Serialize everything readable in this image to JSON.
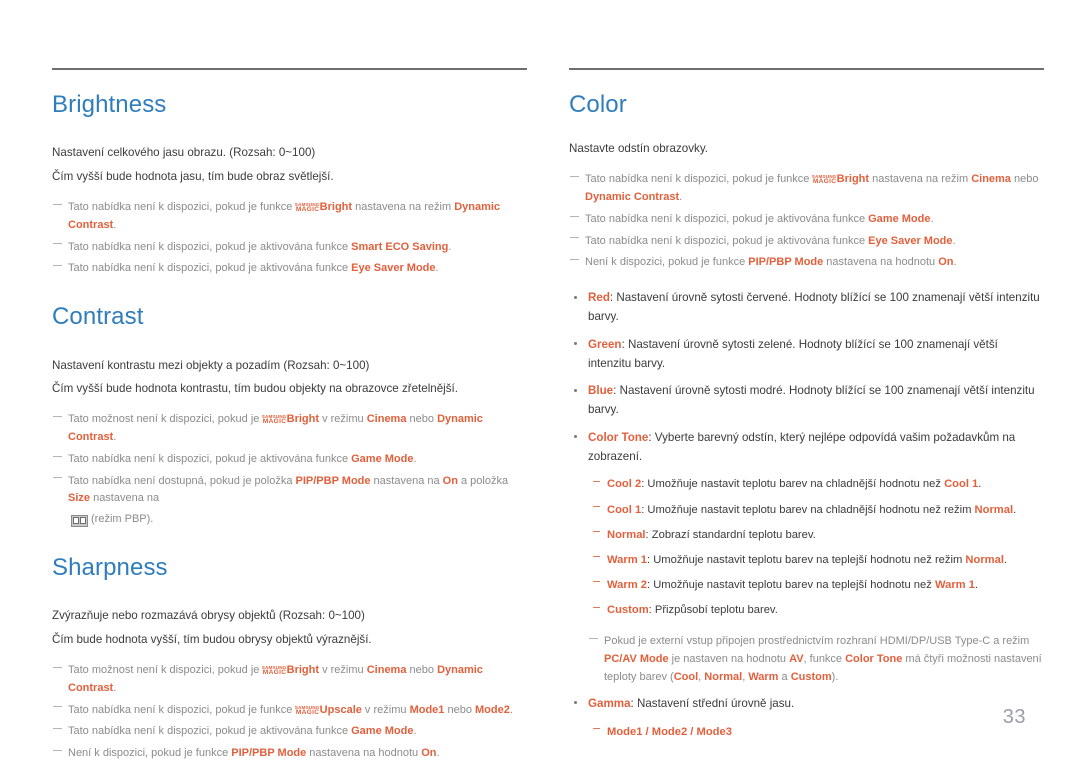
{
  "page_number": "33",
  "colors": {
    "heading": "#2f7dbd",
    "highlight": "#e2603c",
    "body": "#3b3b3b",
    "note": "#8b8b8b",
    "page_number": "#9a9fa6",
    "rule": "#6d6e71"
  },
  "magic_logo": {
    "line1": "SAMSUNG",
    "line2": "MAGIC"
  },
  "left_column": {
    "brightness": {
      "title": "Brightness",
      "body": [
        "Nastavení celkového jasu obrazu. (Rozsah: 0~100)",
        "Čím vyšší bude hodnota jasu, tím bude obraz světlejší."
      ],
      "notes": [
        {
          "parts": [
            {
              "t": "Tato nabídka není k dispozici, pokud je funkce ",
              "s": "plain"
            },
            {
              "t": "MAGIC_LOGO",
              "s": "magic"
            },
            {
              "t": "Bright",
              "s": "magicword"
            },
            {
              "t": " nastavena na režim ",
              "s": "plain"
            },
            {
              "t": "Dynamic Contrast",
              "s": "hl"
            },
            {
              "t": ".",
              "s": "plain"
            }
          ]
        },
        {
          "parts": [
            {
              "t": "Tato nabídka není k dispozici, pokud je aktivována funkce ",
              "s": "plain"
            },
            {
              "t": "Smart ECO Saving",
              "s": "hl"
            },
            {
              "t": ".",
              "s": "plain"
            }
          ]
        },
        {
          "parts": [
            {
              "t": "Tato nabídka není k dispozici, pokud je aktivována funkce ",
              "s": "plain"
            },
            {
              "t": "Eye Saver Mode",
              "s": "hl"
            },
            {
              "t": ".",
              "s": "plain"
            }
          ]
        }
      ]
    },
    "contrast": {
      "title": "Contrast",
      "body": [
        "Nastavení kontrastu mezi objekty a pozadím (Rozsah: 0~100)",
        "Čím vyšší bude hodnota kontrastu, tím budou objekty na obrazovce zřetelnější."
      ],
      "notes": [
        {
          "parts": [
            {
              "t": "Tato možnost není k dispozici, pokud je ",
              "s": "plain"
            },
            {
              "t": "MAGIC_LOGO",
              "s": "magic"
            },
            {
              "t": "Bright",
              "s": "magicword"
            },
            {
              "t": " v režimu ",
              "s": "plain"
            },
            {
              "t": "Cinema",
              "s": "hl"
            },
            {
              "t": " nebo ",
              "s": "plain"
            },
            {
              "t": "Dynamic Contrast",
              "s": "hl"
            },
            {
              "t": ".",
              "s": "plain"
            }
          ]
        },
        {
          "parts": [
            {
              "t": "Tato nabídka není k dispozici, pokud je aktivována funkce ",
              "s": "plain"
            },
            {
              "t": "Game Mode",
              "s": "hl"
            },
            {
              "t": ".",
              "s": "plain"
            }
          ]
        }
      ],
      "pbp_note": {
        "line1_parts": [
          {
            "t": "Tato nabídka není dostupná, pokud je položka ",
            "s": "plain"
          },
          {
            "t": "PIP/PBP Mode",
            "s": "hl"
          },
          {
            "t": " nastavena na ",
            "s": "plain"
          },
          {
            "t": "On",
            "s": "hl"
          },
          {
            "t": " a položka ",
            "s": "plain"
          },
          {
            "t": "Size",
            "s": "hl"
          },
          {
            "t": " nastavena na",
            "s": "plain"
          }
        ],
        "line2_suffix": "(režim PBP)."
      }
    },
    "sharpness": {
      "title": "Sharpness",
      "body": [
        "Zvýrazňuje nebo rozmazává obrysy objektů (Rozsah: 0~100)",
        "Čím bude hodnota vyšší, tím budou obrysy objektů výraznější."
      ],
      "notes": [
        {
          "parts": [
            {
              "t": "Tato možnost není k dispozici, pokud je ",
              "s": "plain"
            },
            {
              "t": "MAGIC_LOGO",
              "s": "magic"
            },
            {
              "t": "Bright",
              "s": "magicword"
            },
            {
              "t": " v režimu ",
              "s": "plain"
            },
            {
              "t": "Cinema",
              "s": "hl"
            },
            {
              "t": " nebo ",
              "s": "plain"
            },
            {
              "t": "Dynamic Contrast",
              "s": "hl"
            },
            {
              "t": ".",
              "s": "plain"
            }
          ]
        },
        {
          "parts": [
            {
              "t": "Tato nabídka není k dispozici, pokud je funkce ",
              "s": "plain"
            },
            {
              "t": "MAGIC_LOGO",
              "s": "magic"
            },
            {
              "t": "Upscale",
              "s": "magicword"
            },
            {
              "t": " v režimu ",
              "s": "plain"
            },
            {
              "t": "Mode1",
              "s": "hl"
            },
            {
              "t": " nebo ",
              "s": "plain"
            },
            {
              "t": "Mode2",
              "s": "hl"
            },
            {
              "t": ".",
              "s": "plain"
            }
          ]
        },
        {
          "parts": [
            {
              "t": "Tato nabídka není k dispozici, pokud je aktivována funkce ",
              "s": "plain"
            },
            {
              "t": "Game Mode",
              "s": "hl"
            },
            {
              "t": ".",
              "s": "plain"
            }
          ]
        },
        {
          "parts": [
            {
              "t": "Není k dispozici, pokud je funkce ",
              "s": "plain"
            },
            {
              "t": "PIP/PBP Mode",
              "s": "hl"
            },
            {
              "t": " nastavena na hodnotu ",
              "s": "plain"
            },
            {
              "t": "On",
              "s": "hl"
            },
            {
              "t": ".",
              "s": "plain"
            }
          ]
        }
      ]
    }
  },
  "right_column": {
    "color": {
      "title": "Color",
      "body": [
        "Nastavte odstín obrazovky."
      ],
      "notes": [
        {
          "parts": [
            {
              "t": "Tato nabídka není k dispozici, pokud je funkce ",
              "s": "plain"
            },
            {
              "t": "MAGIC_LOGO",
              "s": "magic"
            },
            {
              "t": "Bright",
              "s": "magicword"
            },
            {
              "t": " nastavena na režim ",
              "s": "plain"
            },
            {
              "t": "Cinema",
              "s": "hl"
            },
            {
              "t": " nebo ",
              "s": "plain"
            },
            {
              "t": "Dynamic Contrast",
              "s": "hl"
            },
            {
              "t": ".",
              "s": "plain"
            }
          ]
        },
        {
          "parts": [
            {
              "t": "Tato nabídka není k dispozici, pokud je aktivována funkce ",
              "s": "plain"
            },
            {
              "t": "Game Mode",
              "s": "hl"
            },
            {
              "t": ".",
              "s": "plain"
            }
          ]
        },
        {
          "parts": [
            {
              "t": "Tato nabídka není k dispozici, pokud je aktivována funkce ",
              "s": "plain"
            },
            {
              "t": "Eye Saver Mode",
              "s": "hl"
            },
            {
              "t": ".",
              "s": "plain"
            }
          ]
        },
        {
          "parts": [
            {
              "t": "Není k dispozici, pokud je funkce ",
              "s": "plain"
            },
            {
              "t": "PIP/PBP Mode",
              "s": "hl"
            },
            {
              "t": " nastavena na hodnotu ",
              "s": "plain"
            },
            {
              "t": "On",
              "s": "hl"
            },
            {
              "t": ".",
              "s": "plain"
            }
          ]
        }
      ],
      "bullets": [
        {
          "parts": [
            {
              "t": "Red",
              "s": "hl"
            },
            {
              "t": ": Nastavení úrovně sytosti červené. Hodnoty blížící se 100 znamenají větší intenzitu barvy.",
              "s": "plain"
            }
          ]
        },
        {
          "parts": [
            {
              "t": "Green",
              "s": "hl"
            },
            {
              "t": ": Nastavení úrovně sytosti zelené. Hodnoty blížící se 100 znamenají větší intenzitu barvy.",
              "s": "plain"
            }
          ]
        },
        {
          "parts": [
            {
              "t": "Blue",
              "s": "hl"
            },
            {
              "t": ": Nastavení úrovně sytosti modré. Hodnoty blížící se 100 znamenají větší intenzitu barvy.",
              "s": "plain"
            }
          ]
        },
        {
          "parts": [
            {
              "t": "Color Tone",
              "s": "hl"
            },
            {
              "t": ": Vyberte barevný odstín, který nejlépe odpovídá vašim požadavkům na zobrazení.",
              "s": "plain"
            }
          ]
        }
      ],
      "color_tone_options": [
        {
          "parts": [
            {
              "t": "Cool 2",
              "s": "hl"
            },
            {
              "t": ": Umožňuje nastavit teplotu barev na chladnější hodnotu než ",
              "s": "plain"
            },
            {
              "t": "Cool 1",
              "s": "hl"
            },
            {
              "t": ".",
              "s": "plain"
            }
          ]
        },
        {
          "parts": [
            {
              "t": "Cool 1",
              "s": "hl"
            },
            {
              "t": ": Umožňuje nastavit teplotu barev na chladnější hodnotu než režim ",
              "s": "plain"
            },
            {
              "t": "Normal",
              "s": "hl"
            },
            {
              "t": ".",
              "s": "plain"
            }
          ]
        },
        {
          "parts": [
            {
              "t": "Normal",
              "s": "hl"
            },
            {
              "t": ": Zobrazí standardní teplotu barev.",
              "s": "plain"
            }
          ]
        },
        {
          "parts": [
            {
              "t": "Warm 1",
              "s": "hl"
            },
            {
              "t": ": Umožňuje nastavit teplotu barev na teplejší hodnotu než režim ",
              "s": "plain"
            },
            {
              "t": "Normal",
              "s": "hl"
            },
            {
              "t": ".",
              "s": "plain"
            }
          ]
        },
        {
          "parts": [
            {
              "t": "Warm 2",
              "s": "hl"
            },
            {
              "t": ": Umožňuje nastavit teplotu barev na teplejší hodnotu než ",
              "s": "plain"
            },
            {
              "t": "Warm 1",
              "s": "hl"
            },
            {
              "t": ".",
              "s": "plain"
            }
          ]
        },
        {
          "parts": [
            {
              "t": "Custom",
              "s": "hl"
            },
            {
              "t": ": Přizpůsobí teplotu barev.",
              "s": "plain"
            }
          ]
        }
      ],
      "av_note": {
        "parts": [
          {
            "t": "Pokud je externí vstup připojen prostřednictvím rozhraní HDMI/DP/USB Type-C a režim ",
            "s": "plain"
          },
          {
            "t": "PC/AV Mode",
            "s": "hl"
          },
          {
            "t": " je nastaven na hodnotu ",
            "s": "plain"
          },
          {
            "t": "AV",
            "s": "hl"
          },
          {
            "t": ", funkce ",
            "s": "plain"
          },
          {
            "t": "Color Tone",
            "s": "hl"
          },
          {
            "t": " má čtyři možnosti nastavení teploty barev (",
            "s": "plain"
          },
          {
            "t": "Cool",
            "s": "hl"
          },
          {
            "t": ", ",
            "s": "plain"
          },
          {
            "t": "Normal",
            "s": "hl"
          },
          {
            "t": ", ",
            "s": "plain"
          },
          {
            "t": "Warm",
            "s": "hl"
          },
          {
            "t": " a ",
            "s": "plain"
          },
          {
            "t": "Custom",
            "s": "hl"
          },
          {
            "t": ").",
            "s": "plain"
          }
        ]
      },
      "gamma_bullet": {
        "parts": [
          {
            "t": "Gamma",
            "s": "hl"
          },
          {
            "t": ": Nastavení střední úrovně jasu.",
            "s": "plain"
          }
        ]
      },
      "gamma_options": {
        "parts": [
          {
            "t": "Mode1 / Mode2 / Mode3",
            "s": "hl"
          }
        ]
      }
    }
  }
}
